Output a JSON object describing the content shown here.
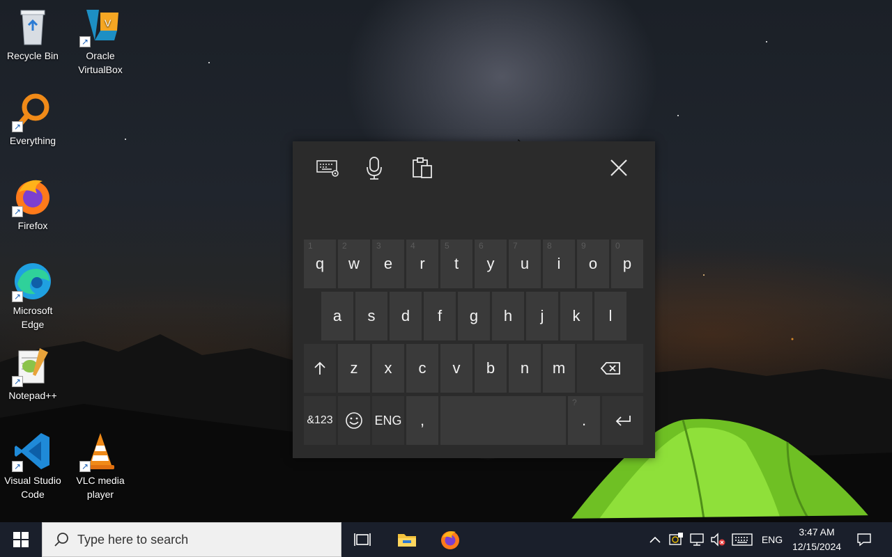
{
  "desktop": {
    "icons": [
      {
        "label": "Recycle Bin",
        "icon": "recycle-bin-icon"
      },
      {
        "label": "Oracle VirtualBox",
        "icon": "virtualbox-icon"
      },
      {
        "label": "Everything",
        "icon": "everything-search-icon"
      },
      {
        "label": "Firefox",
        "icon": "firefox-icon"
      },
      {
        "label": "Microsoft Edge",
        "icon": "edge-icon"
      },
      {
        "label": "Notepad++",
        "icon": "notepadpp-icon"
      },
      {
        "label": "Visual Studio Code",
        "icon": "vscode-icon"
      },
      {
        "label": "VLC media player",
        "icon": "vlc-icon"
      }
    ]
  },
  "keyboard": {
    "toolbar": [
      "keyboard-settings-icon",
      "microphone-icon",
      "clipboard-icon",
      "close-icon"
    ],
    "row1": [
      {
        "key": "q",
        "hint": "1"
      },
      {
        "key": "w",
        "hint": "2"
      },
      {
        "key": "e",
        "hint": "3"
      },
      {
        "key": "r",
        "hint": "4"
      },
      {
        "key": "t",
        "hint": "5"
      },
      {
        "key": "y",
        "hint": "6"
      },
      {
        "key": "u",
        "hint": "7"
      },
      {
        "key": "i",
        "hint": "8"
      },
      {
        "key": "o",
        "hint": "9"
      },
      {
        "key": "p",
        "hint": "0"
      }
    ],
    "row2": [
      "a",
      "s",
      "d",
      "f",
      "g",
      "h",
      "j",
      "k",
      "l"
    ],
    "row3": [
      "z",
      "x",
      "c",
      "v",
      "b",
      "n",
      "m"
    ],
    "symbols_key": "&123",
    "language_key": "ENG",
    "comma_key": ",",
    "period_key": ".",
    "period_hint": "?"
  },
  "taskbar": {
    "search_placeholder": "Type here to search",
    "language": "ENG",
    "time": "3:47 AM",
    "date": "12/15/2024"
  },
  "colors": {
    "keyboard_bg": "#2b2b2b",
    "key_bg": "#3a3a3a",
    "taskbar_bg": "#1a1f2b",
    "tent_green": "#7cd12a"
  }
}
